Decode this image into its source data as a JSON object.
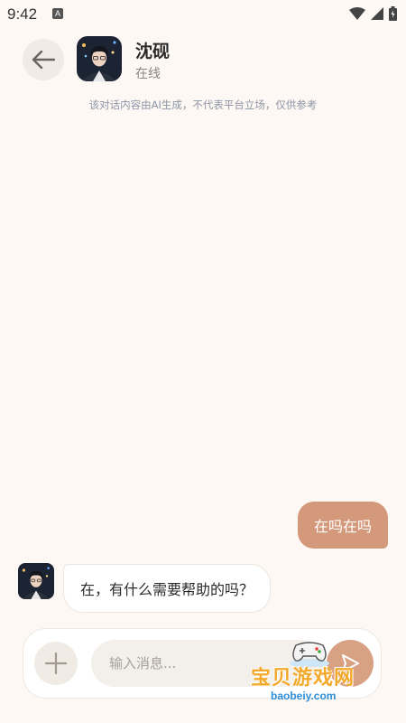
{
  "status_bar": {
    "time": "9:42",
    "notification_icon": "A"
  },
  "header": {
    "back_icon": "arrow-left-icon",
    "character_name": "沈砚",
    "character_status": "在线",
    "disclaimer": "该对话内容由AI生成，不代表平台立场，仅供参考"
  },
  "messages": [
    {
      "sender": "user",
      "text": "在吗在吗"
    },
    {
      "sender": "bot",
      "text": "在，有什么需要帮助的吗？"
    }
  ],
  "composer": {
    "placeholder": "输入消息...",
    "attach_icon": "plus-icon",
    "send_icon": "send-icon"
  },
  "watermark": {
    "title": "宝贝游戏网",
    "url": "baobeiy.com"
  },
  "colors": {
    "background": "#fdf8f3",
    "user_bubble": "#d4997a",
    "send_button": "#d9a184",
    "disclaimer": "#8d95a8"
  }
}
